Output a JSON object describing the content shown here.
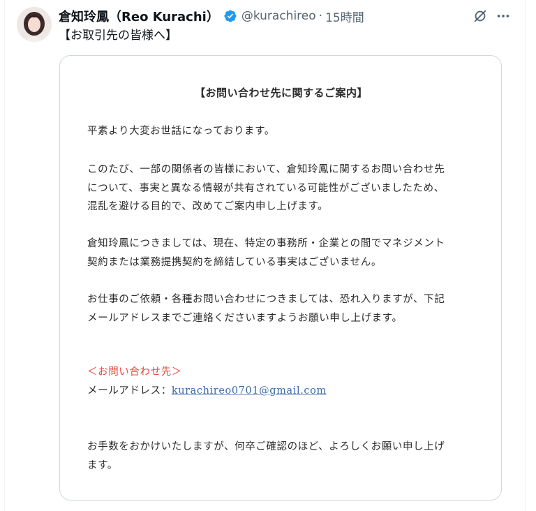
{
  "user": {
    "display_name": "倉知玲鳳（Reo Kurachi）",
    "handle": "@kurachireo",
    "separator": "·",
    "time": "15時間"
  },
  "tweet": {
    "text": "【お取引先の皆様へ】"
  },
  "notice": {
    "title": "【お問い合わせ先に関するご案内】",
    "greeting": "平素より大変お世話になっております。",
    "paragraph1": [
      "このたび、一部の関係者の皆様において、倉知玲鳳に関するお問い合わせ先",
      "について、事実と異なる情報が共有されている可能性がございましたため、",
      "混乱を避ける目的で、改めてご案内申し上げます。"
    ],
    "paragraph2": [
      "倉知玲鳳につきましては、現在、特定の事務所・企業との間でマネジメント",
      "契約または業務提携契約を締結している事実はございません。"
    ],
    "paragraph3": [
      "お仕事のご依頼・各種お問い合わせにつきましては、恐れ入りますが、下記",
      "メールアドレスまでご連絡くださいますようお願い申し上げます。"
    ],
    "contact_heading": "＜お問い合わせ先＞",
    "email_label": "メールアドレス：",
    "email": "kurachireo0701@gmail.com",
    "closing": [
      "お手数をおかけいたしますが、何卒ご確認のほど、よろしくお願い申し上げ",
      "ます。"
    ]
  },
  "icons": {
    "verified": "verified-badge-icon",
    "grok": "grok-icon",
    "more": "more-icon"
  },
  "colors": {
    "verified": "#1d9bf0",
    "handle": "#536471",
    "contact_heading": "#e8453c",
    "email_link": "#3a6aa8"
  }
}
